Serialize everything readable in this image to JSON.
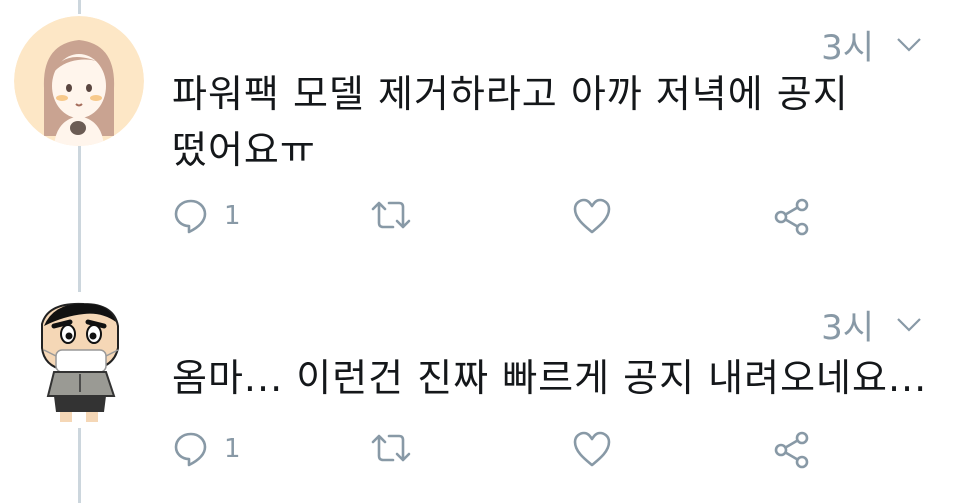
{
  "tweets": [
    {
      "time": "3시",
      "text_line1": "파워팩 모델 제거하라고 아까 저녁에 공지",
      "text_line2": "떴어요ㅠ",
      "reply_count": "1",
      "avatar_icon": "girl-avatar-icon"
    },
    {
      "time": "3시",
      "text_line1": "옴마... 이런건 진짜 빠르게 공지 내려오네요...",
      "reply_count": "1",
      "avatar_icon": "shinchan-avatar-icon"
    }
  ],
  "colors": {
    "text": "#14171a",
    "muted": "#8899a6",
    "thread_line": "#ccd6dd"
  }
}
